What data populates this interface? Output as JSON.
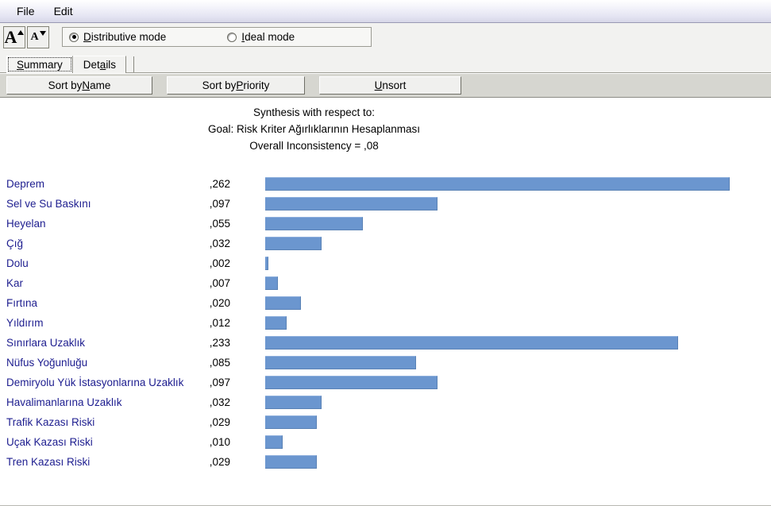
{
  "menu": {
    "items": [
      {
        "label": "File"
      },
      {
        "label": "Edit"
      }
    ]
  },
  "toolbar": {
    "increase_font_label": "A",
    "decrease_font_label": "A",
    "mode_group": {
      "options": [
        {
          "label_pre": "",
          "accel": "D",
          "label_post": "istributive mode",
          "selected": true
        },
        {
          "label_pre": "",
          "accel": "I",
          "label_post": "deal mode",
          "selected": false
        }
      ]
    }
  },
  "tabs": [
    {
      "label_pre": "",
      "accel": "S",
      "label_post": "ummary",
      "selected": true
    },
    {
      "label_pre": "Det",
      "accel": "a",
      "label_post": "ils",
      "selected": false
    }
  ],
  "sort_buttons": [
    {
      "label_pre": "Sort by ",
      "accel": "N",
      "label_post": "ame"
    },
    {
      "label_pre": "Sort by ",
      "accel": "P",
      "label_post": "riority"
    },
    {
      "label_pre": "",
      "accel": "U",
      "label_post": "nsort"
    }
  ],
  "headings": {
    "line1": "Synthesis with respect to:",
    "line2": "Goal: Risk Kriter Ağırlıklarının Hesaplanması",
    "line3": "Overall Inconsistency = ,08"
  },
  "colors": {
    "bar_fill": "#6b96cf",
    "bar_edge": "#5a82b5",
    "label_text": "#1d1d8f",
    "value_text": "#000000",
    "pane_background": "#ffffff",
    "toolbar_background": "#f2f2f0",
    "sortbar_background": "#d6d6d0"
  },
  "chart_data": {
    "type": "bar",
    "orientation": "horizontal",
    "title": "Synthesis with respect to: Goal: Risk Kriter Ağırlıklarının Hesaplanması",
    "subtitle": "Overall Inconsistency = ,08",
    "xlabel": "",
    "ylabel": "",
    "xlim": [
      0,
      0.2715
    ],
    "grid": false,
    "legend": null,
    "decimal_separator": ",",
    "categories": [
      "Deprem",
      "Sel ve Su Baskını",
      "Heyelan",
      "Çığ",
      "Dolu",
      "Kar",
      "Fırtına",
      "Yıldırım",
      "Sınırlara Uzaklık",
      "Nüfus Yoğunluğu",
      "Demiryolu Yük İstasyonlarına Uzaklık",
      "Havalimanlarına Uzaklık",
      "Trafik Kazası Riski",
      "Uçak Kazası Riski",
      "Tren Kazası Riski"
    ],
    "values": [
      0.262,
      0.097,
      0.055,
      0.032,
      0.002,
      0.007,
      0.02,
      0.012,
      0.233,
      0.085,
      0.097,
      0.032,
      0.029,
      0.01,
      0.029
    ],
    "value_labels": [
      ",262",
      ",097",
      ",055",
      ",032",
      ",002",
      ",007",
      ",020",
      ",012",
      ",233",
      ",085",
      ",097",
      ",032",
      ",029",
      ",010",
      ",029"
    ]
  }
}
